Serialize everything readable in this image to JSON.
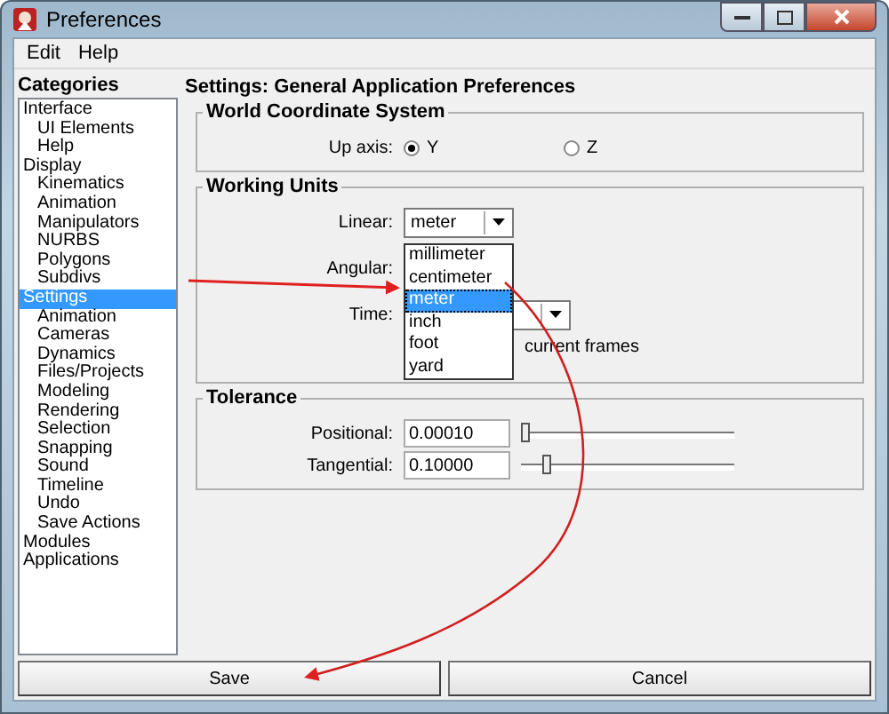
{
  "window": {
    "title": "Preferences"
  },
  "menu": [
    "Edit",
    "Help"
  ],
  "categories": {
    "label": "Categories",
    "items": [
      {
        "label": "Interface",
        "selected": false,
        "children": [
          {
            "label": "UI Elements",
            "selected": false
          },
          {
            "label": "Help",
            "selected": false
          }
        ]
      },
      {
        "label": "Display",
        "selected": false,
        "children": [
          {
            "label": "Kinematics",
            "selected": false
          },
          {
            "label": "Animation",
            "selected": false
          },
          {
            "label": "Manipulators",
            "selected": false
          },
          {
            "label": "NURBS",
            "selected": false
          },
          {
            "label": "Polygons",
            "selected": false
          },
          {
            "label": "Subdivs",
            "selected": false
          }
        ]
      },
      {
        "label": "Settings",
        "selected": true,
        "children": [
          {
            "label": "Animation",
            "selected": false
          },
          {
            "label": "Cameras",
            "selected": false
          },
          {
            "label": "Dynamics",
            "selected": false
          },
          {
            "label": "Files/Projects",
            "selected": false
          },
          {
            "label": "Modeling",
            "selected": false
          },
          {
            "label": "Rendering",
            "selected": false
          },
          {
            "label": "Selection",
            "selected": false
          },
          {
            "label": "Snapping",
            "selected": false
          },
          {
            "label": "Sound",
            "selected": false
          },
          {
            "label": "Timeline",
            "selected": false
          },
          {
            "label": "Undo",
            "selected": false
          },
          {
            "label": "Save Actions",
            "selected": false
          }
        ]
      },
      {
        "label": "Modules",
        "selected": false
      },
      {
        "label": "Applications",
        "selected": false
      }
    ]
  },
  "heading": "Settings: General Application Preferences",
  "world": {
    "title": "World Coordinate System",
    "label": "Up axis:",
    "options": [
      {
        "label": "Y",
        "selected": true
      },
      {
        "label": "Z",
        "selected": false
      }
    ]
  },
  "units": {
    "title": "Working Units",
    "linear": {
      "label": "Linear:",
      "value": "meter",
      "options": [
        {
          "label": "millimeter",
          "selected": false
        },
        {
          "label": "centimeter",
          "selected": false
        },
        {
          "label": "meter",
          "selected": true
        },
        {
          "label": "inch",
          "selected": false
        },
        {
          "label": "foot",
          "selected": false
        },
        {
          "label": "yard",
          "selected": false
        }
      ]
    },
    "angular": {
      "label": "Angular:"
    },
    "time": {
      "label": "Time:"
    },
    "note": "current frames"
  },
  "tolerance": {
    "title": "Tolerance",
    "rows": [
      {
        "label": "Positional:",
        "value": "0.00010",
        "level": 0.02
      },
      {
        "label": "Tangential:",
        "value": "0.10000",
        "level": 0.12
      }
    ]
  },
  "buttons": [
    "Save",
    "Cancel"
  ]
}
